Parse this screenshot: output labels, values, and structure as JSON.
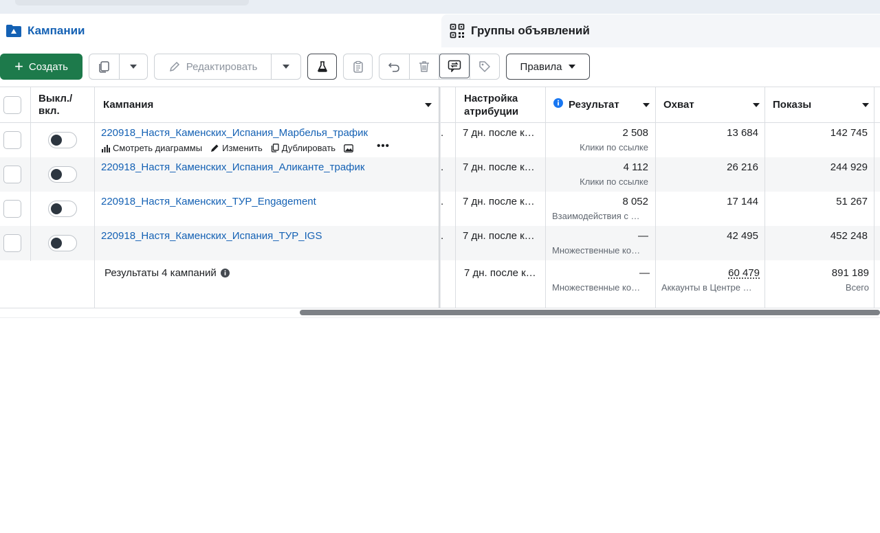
{
  "tabs": {
    "campaigns": "Кампании",
    "adsets": "Группы объявлений"
  },
  "toolbar": {
    "create_label": "Создать",
    "edit_label": "Редактировать",
    "rules_label": "Правила"
  },
  "colors": {
    "accent": "#1461b4",
    "create": "#1d7a4b"
  },
  "table": {
    "headers": {
      "toggle": "Выкл./ вкл.",
      "campaign": "Кампания",
      "attribution": "Настройка атрибуции",
      "result": "Результат",
      "reach": "Охват",
      "impressions": "Показы"
    },
    "row_actions": {
      "charts": "Смотреть диаграммы",
      "edit": "Изменить",
      "duplicate": "Дублировать"
    },
    "rows": [
      {
        "name": "220918_Настя_Каменских_Испания_Марбелья_трафик",
        "attribution": "7 дн. после к…",
        "result": "2 508",
        "result_type": "Клики по ссылке",
        "reach": "13 684",
        "impressions": "142 745"
      },
      {
        "name": "220918_Настя_Каменских_Испания_Аликанте_трафик",
        "attribution": "7 дн. после к…",
        "result": "4 112",
        "result_type": "Клики по ссылке",
        "reach": "26 216",
        "impressions": "244 929"
      },
      {
        "name": "220918_Настя_Каменских_ТУР_Engagement",
        "attribution": "7 дн. после к…",
        "result": "8 052",
        "result_type": "Взаимодействия с …",
        "reach": "17 144",
        "impressions": "51 267"
      },
      {
        "name": "220918_Настя_Каменских_Испания_ТУР_IGS",
        "attribution": "7 дн. после к…",
        "result": "—",
        "result_type": "Множественные ко…",
        "reach": "42 495",
        "impressions": "452 248"
      }
    ],
    "totals": {
      "label": "Результаты 4 кампаний",
      "attribution": "7 дн. после к…",
      "result": "—",
      "result_type": "Множественные ко…",
      "reach": "60 479",
      "reach_type": "Аккаунты в Центре …",
      "impressions": "891 189",
      "impressions_type": "Всего"
    }
  }
}
